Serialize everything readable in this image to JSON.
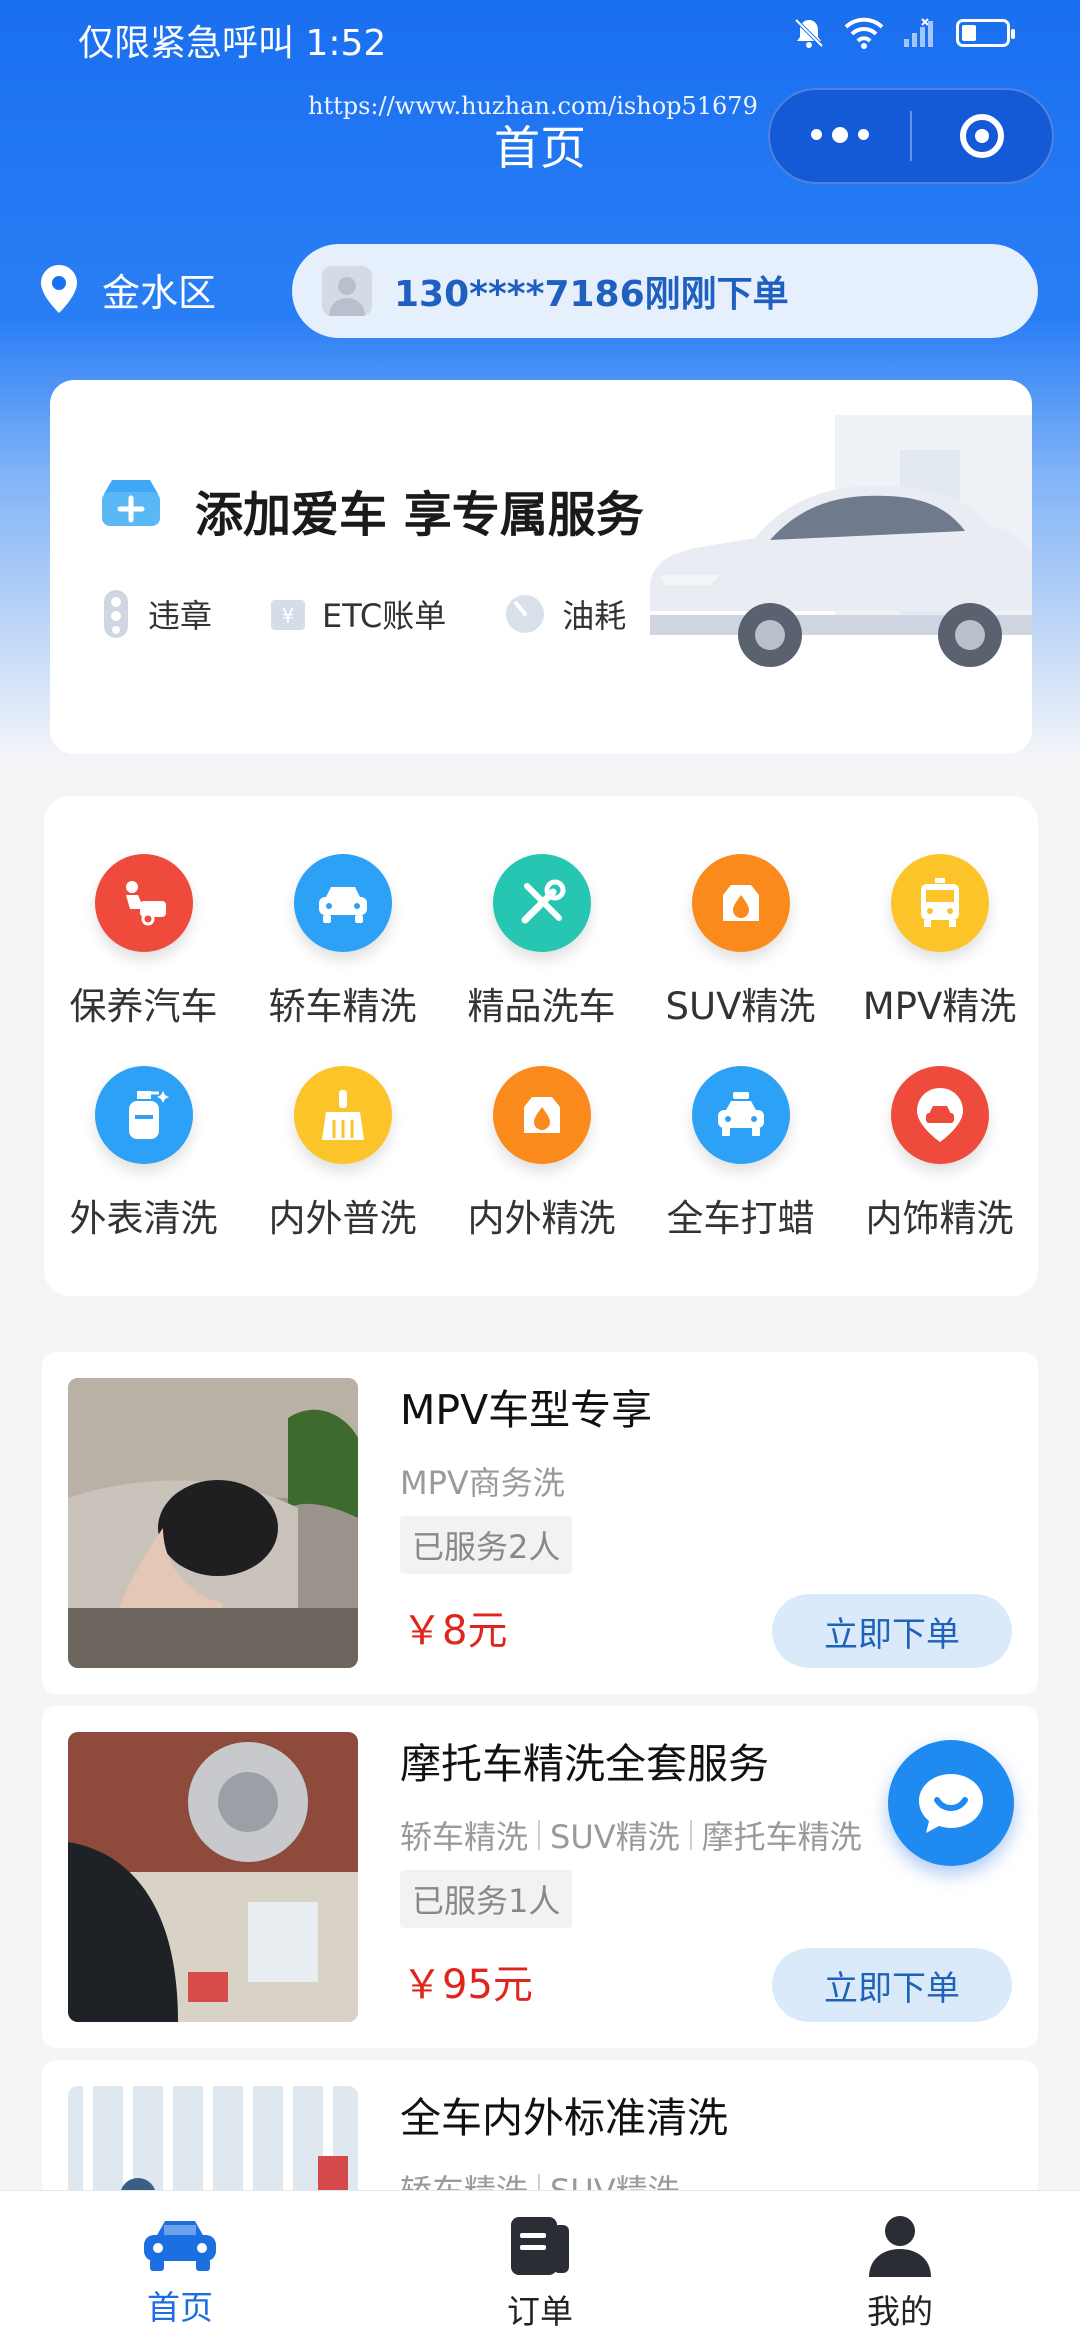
{
  "status_bar": {
    "time_text": "仅限紧急呼叫 1:52"
  },
  "watermark": "https://www.huzhan.com/ishop51679",
  "header": {
    "title": "首页"
  },
  "location": {
    "name": "金水区"
  },
  "notice": {
    "text": "130****7186刚刚下单"
  },
  "banner": {
    "title": "添加爱车 享专属服务",
    "features": [
      {
        "label": "违章",
        "icon": "traffic-light-icon"
      },
      {
        "label": "ETC账单",
        "icon": "etc-card-icon"
      },
      {
        "label": "油耗",
        "icon": "gauge-icon"
      }
    ]
  },
  "services": [
    {
      "label": "保养汽车",
      "icon": "car-maintenance-icon",
      "color": "#ef4b3c"
    },
    {
      "label": "轿车精洗",
      "icon": "sedan-icon",
      "color": "#2da1f5"
    },
    {
      "label": "精品洗车",
      "icon": "tools-icon",
      "color": "#26c6b3"
    },
    {
      "label": "SUV精洗",
      "icon": "suv-icon",
      "color": "#fb8a1c"
    },
    {
      "label": "MPV精洗",
      "icon": "bus-icon",
      "color": "#fbc52a"
    },
    {
      "label": "外表清洗",
      "icon": "spray-bottle-icon",
      "color": "#2da1f5"
    },
    {
      "label": "内外普洗",
      "icon": "broom-icon",
      "color": "#fbc52a"
    },
    {
      "label": "内外精洗",
      "icon": "car-seat-icon",
      "color": "#fb8a1c"
    },
    {
      "label": "全车打蜡",
      "icon": "taxi-icon",
      "color": "#2da1f5"
    },
    {
      "label": "内饰精洗",
      "icon": "car-pin-icon",
      "color": "#ef4b3c"
    }
  ],
  "products": [
    {
      "title": "MPV车型专享",
      "tags": [
        "MPV商务洗"
      ],
      "served": "已服务2人",
      "price": "￥8元",
      "order_label": "立即下单"
    },
    {
      "title": "摩托车精洗全套服务",
      "tags": [
        "轿车精洗",
        "SUV精洗",
        "摩托车精洗"
      ],
      "served": "已服务1人",
      "price": "￥95元",
      "order_label": "立即下单"
    },
    {
      "title": "全车内外标准清洗",
      "tags": [
        "轿车精洗",
        "SUV精洗"
      ]
    }
  ],
  "tabbar": [
    {
      "label": "首页",
      "icon": "car-icon",
      "active": true
    },
    {
      "label": "订单",
      "icon": "order-book-icon",
      "active": false
    },
    {
      "label": "我的",
      "icon": "user-icon",
      "active": false
    }
  ],
  "colors": {
    "primary": "#1a6ff0",
    "price": "#e0261c",
    "tab_active": "#1c6fe0"
  }
}
